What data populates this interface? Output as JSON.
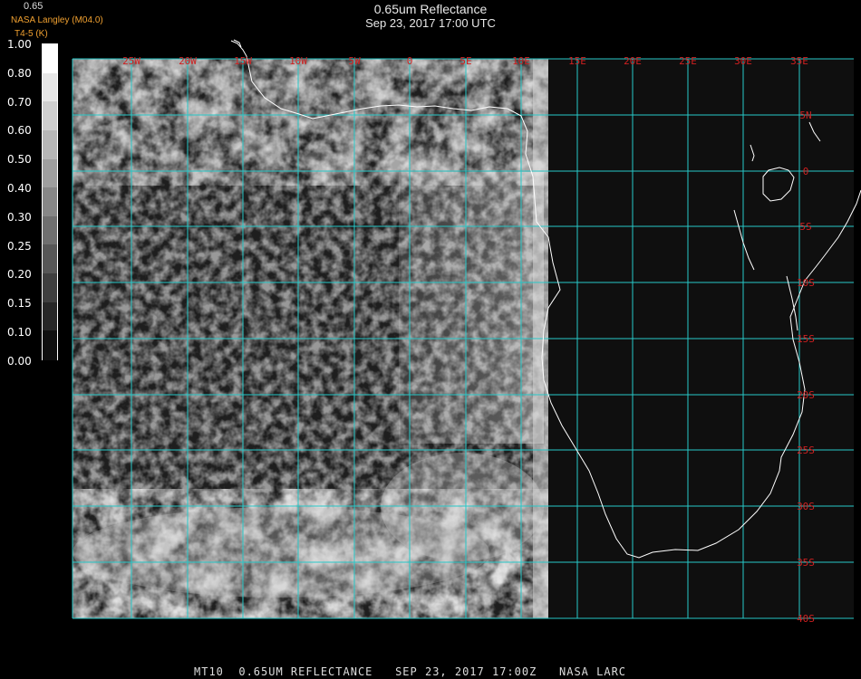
{
  "header": {
    "title_line1": "0.65um Reflectance",
    "title_line2": "Sep 23, 2017 17:00 UTC",
    "top_label": "0.65",
    "producer": "NASA Langley (M04.0)",
    "subtitle_label": "T4-5 (K)"
  },
  "colorbar": {
    "ticks": [
      "1.00",
      "0.80",
      "0.70",
      "0.60",
      "0.50",
      "0.40",
      "0.30",
      "0.25",
      "0.20",
      "0.15",
      "0.10",
      "0.00"
    ]
  },
  "map": {
    "lon_labels": [
      "25W",
      "20W",
      "15W",
      "10W",
      "5W",
      "0",
      "5E",
      "10E",
      "15E",
      "20E",
      "25E",
      "30E",
      "35E"
    ],
    "lat_labels": [
      "5N",
      "0",
      "5S",
      "10S",
      "15S",
      "20S",
      "25S",
      "30S",
      "35S",
      "40S"
    ],
    "grid_color": "#27c8c8",
    "coast_color": "#ffffff",
    "label_color": "#d02020"
  },
  "footer": {
    "text": "MT10  0.65UM REFLECTANCE   SEP 23, 2017 17:00Z   NASA LARC"
  }
}
